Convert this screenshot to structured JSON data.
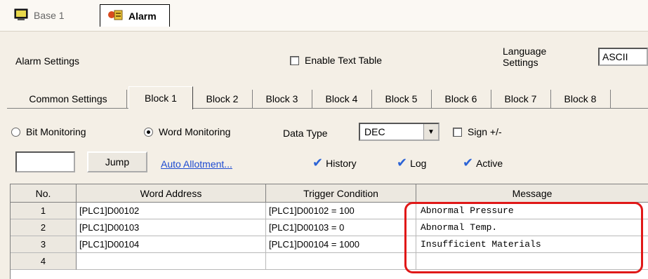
{
  "doc_tabs": [
    {
      "label": "Base 1",
      "icon": "screen-icon"
    },
    {
      "label": "Alarm",
      "icon": "alarm-icon"
    }
  ],
  "settings": {
    "title": "Alarm Settings",
    "enable_text_table": "Enable Text Table",
    "language_label": "Language Settings",
    "language_label_line1": "Language",
    "language_label_line2": "Settings",
    "language_value": "ASCII"
  },
  "block_tabs": [
    "Common Settings",
    "Block 1",
    "Block 2",
    "Block 3",
    "Block 4",
    "Block 5",
    "Block 6",
    "Block 7",
    "Block 8"
  ],
  "active_block_tab": "Block 1",
  "monitoring": {
    "bit_label": "Bit Monitoring",
    "word_label": "Word Monitoring",
    "selected": "Word Monitoring",
    "data_type_label": "Data Type",
    "data_type_value": "DEC",
    "sign_label": "Sign +/-"
  },
  "actions": {
    "jump_label": "Jump",
    "auto_allotment_label": "Auto Allotment...",
    "history_label": "History",
    "log_label": "Log",
    "active_label": "Active"
  },
  "table": {
    "columns": [
      "No.",
      "Word Address",
      "Trigger Condition",
      "Message"
    ],
    "rows": [
      {
        "no": "1",
        "address": "[PLC1]D00102",
        "trigger": "[PLC1]D00102 = 100",
        "message": "Abnormal Pressure"
      },
      {
        "no": "2",
        "address": "[PLC1]D00103",
        "trigger": "[PLC1]D00103 = 0",
        "message": "Abnormal Temp."
      },
      {
        "no": "3",
        "address": "[PLC1]D00104",
        "trigger": "[PLC1]D00104 = 1000",
        "message": "Insufficient Materials"
      },
      {
        "no": "4",
        "address": "",
        "trigger": "",
        "message": ""
      }
    ]
  },
  "colors": {
    "highlight": "#e01818",
    "link": "#1e4bd1",
    "check": "#2b63d6"
  }
}
